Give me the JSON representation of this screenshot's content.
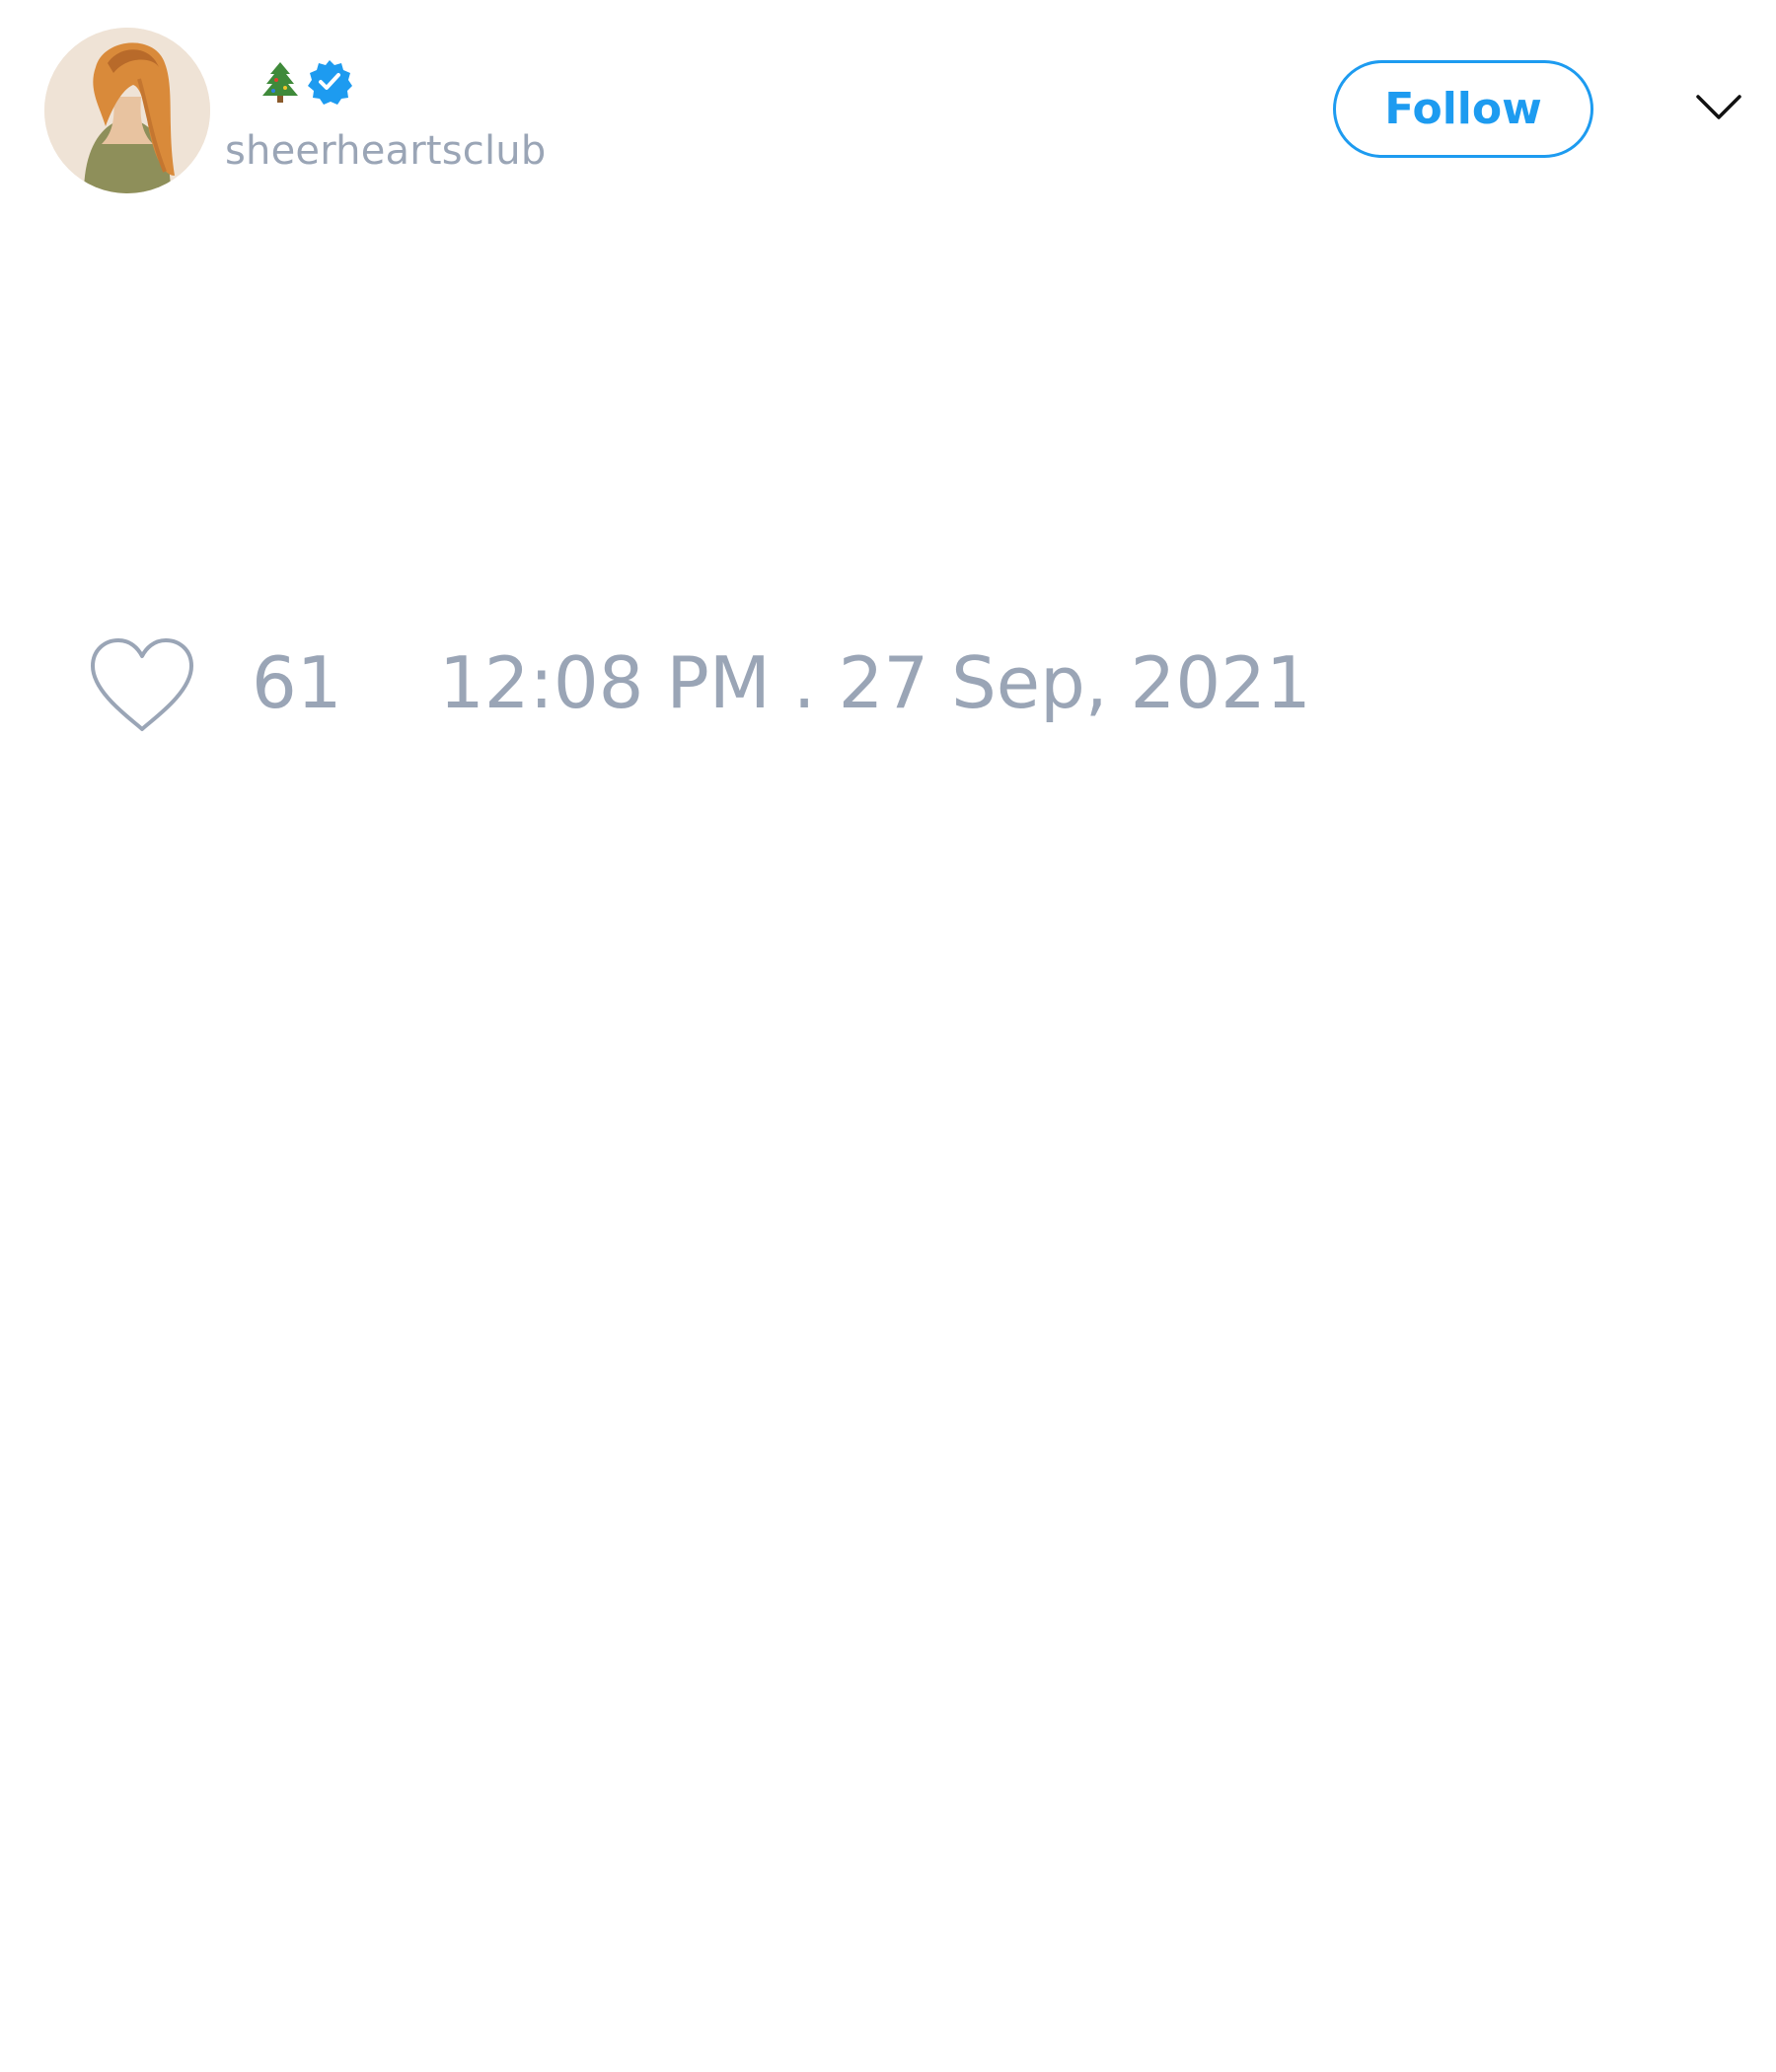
{
  "tweet": {
    "author": {
      "display_emoji_icon": "christmas-tree-icon",
      "verified_icon": "verified-badge-icon",
      "handle": "sheerheartsclub"
    },
    "follow_label": "Follow",
    "menu_icon": "chevron-down-icon",
    "like_icon": "heart-outline-icon",
    "like_count": "61",
    "timestamp": "12:08 PM . 27 Sep, 2021"
  },
  "colors": {
    "accent": "#1d9bf0",
    "muted_text": "#9aa5b6",
    "background": "#ffffff"
  }
}
